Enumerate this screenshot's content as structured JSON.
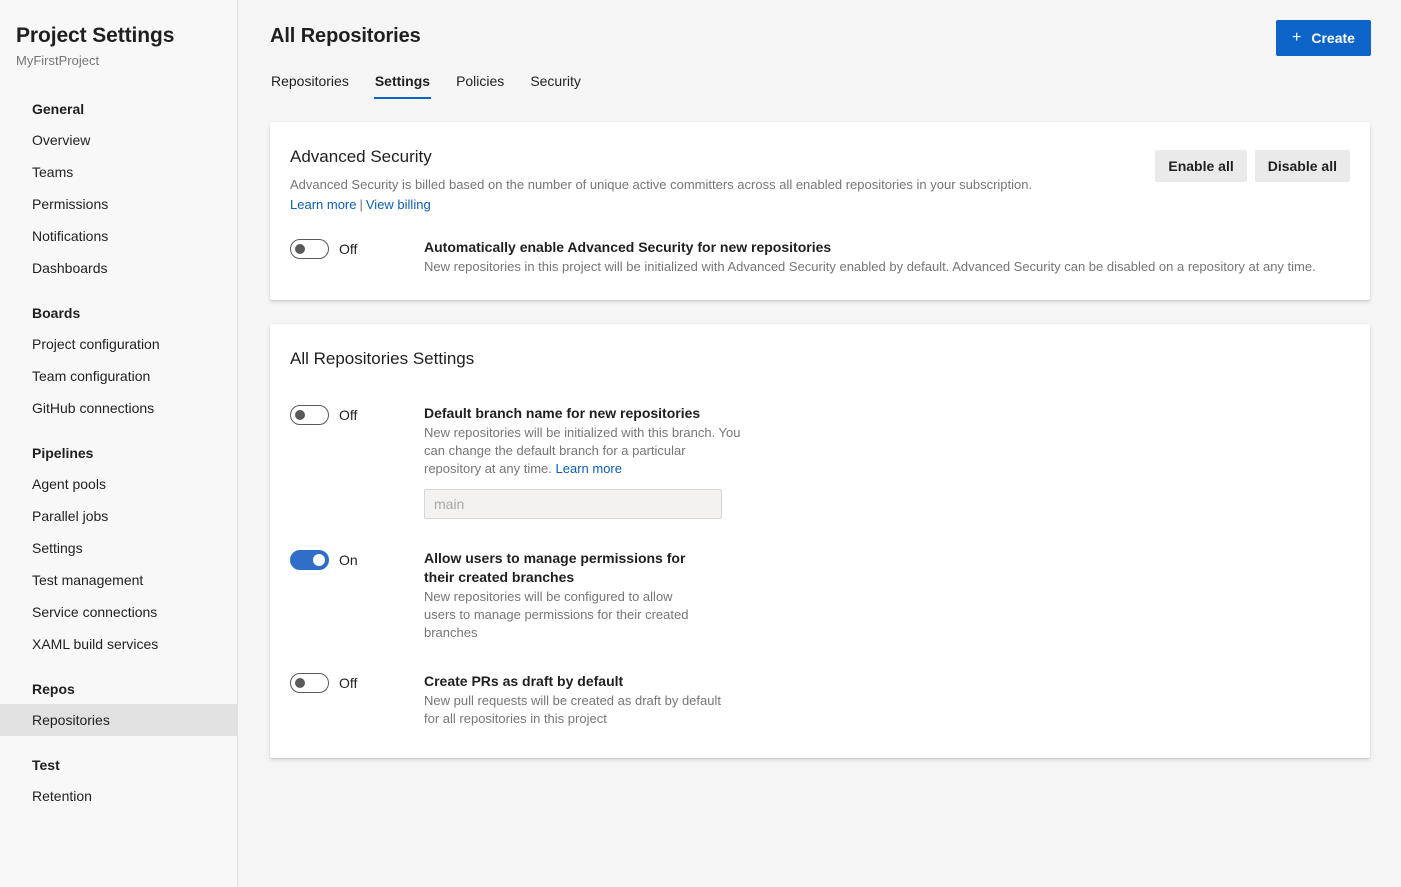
{
  "sidebar": {
    "title": "Project Settings",
    "subtitle": "MyFirstProject",
    "groups": [
      {
        "header": "General",
        "items": [
          "Overview",
          "Teams",
          "Permissions",
          "Notifications",
          "Dashboards"
        ]
      },
      {
        "header": "Boards",
        "items": [
          "Project configuration",
          "Team configuration",
          "GitHub connections"
        ]
      },
      {
        "header": "Pipelines",
        "items": [
          "Agent pools",
          "Parallel jobs",
          "Settings",
          "Test management",
          "Service connections",
          "XAML build services"
        ]
      },
      {
        "header": "Repos",
        "items": [
          "Repositories"
        ]
      },
      {
        "header": "Test",
        "items": [
          "Retention"
        ]
      }
    ],
    "selected_item": "Repositories"
  },
  "header": {
    "title": "All Repositories",
    "create_label": "Create",
    "create_icon": "plus-icon",
    "tabs": [
      {
        "label": "Repositories",
        "active": false
      },
      {
        "label": "Settings",
        "active": true
      },
      {
        "label": "Policies",
        "active": false
      },
      {
        "label": "Security",
        "active": false
      }
    ]
  },
  "advanced_security": {
    "heading": "Advanced Security",
    "description": "Advanced Security is billed based on the number of unique active committers across all enabled repositories in your subscription.",
    "learn_more": "Learn more",
    "separator": "|",
    "view_billing": "View billing",
    "enable_all": "Enable all",
    "disable_all": "Disable all",
    "toggle": {
      "state": "Off",
      "title": "Automatically enable Advanced Security for new repositories",
      "description": "New repositories in this project will be initialized with Advanced Security enabled by default. Advanced Security can be disabled on a repository at any time."
    }
  },
  "all_repositories_settings": {
    "heading": "All Repositories Settings",
    "settings": [
      {
        "state": "Off",
        "on": false,
        "title": "Default branch name for new repositories",
        "description": "New repositories will be initialized with this branch. You can change the default branch for a particular repository at any time.",
        "link": "Learn more",
        "input_placeholder": "main",
        "input_value": ""
      },
      {
        "state": "On",
        "on": true,
        "title": "Allow users to manage permissions for their created branches",
        "description": "New repositories will be configured to allow users to manage permissions for their created branches"
      },
      {
        "state": "Off",
        "on": false,
        "title": "Create PRs as draft by default",
        "description": "New pull requests will be created as draft by default for all repositories in this project"
      }
    ]
  },
  "colors": {
    "accent": "#0d64c8",
    "toggle_on": "#2f6fc8",
    "link": "#0d5ead",
    "page_bg": "#f5f5f5",
    "sidebar_bg": "#f8f8f8",
    "selected_bg": "#e1e1e1"
  }
}
